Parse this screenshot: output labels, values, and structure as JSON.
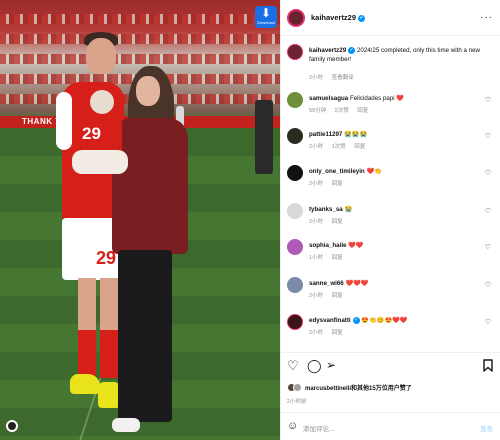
{
  "photo": {
    "banner_text": "THANK YOU",
    "man_number": "29",
    "baby_number": "29",
    "download_label": "Download"
  },
  "post": {
    "author": "kaihavertz29",
    "caption": "2024/25 completed, only this time with a new family member!",
    "caption_time": "2小时",
    "translate_label": "查看翻译",
    "more_label": "···"
  },
  "comments": [
    {
      "user": "samuelsagua",
      "text": "Felicidades papi ❤️",
      "time": "59分钟",
      "likes": "2次赞",
      "reply": "回复",
      "avatar_color": "#6b8f3b"
    },
    {
      "user": "pattie11297",
      "text": "😭😭😭",
      "time": "2小时",
      "likes": "1次赞",
      "reply": "回复",
      "avatar_color": "#2b2b1e"
    },
    {
      "user": "only_one_timileyin",
      "text": "❤️👏",
      "time": "2小时",
      "likes": "",
      "reply": "回复",
      "avatar_color": "#111111"
    },
    {
      "user": "tybanks_sa",
      "text": "😭",
      "time": "2小时",
      "likes": "",
      "reply": "回复",
      "avatar_color": "#d8d8d8"
    },
    {
      "user": "sophia_haile",
      "text": "❤️❤️",
      "time": "1小时",
      "likes": "",
      "reply": "回复",
      "avatar_color": "#b05ab8"
    },
    {
      "user": "sanne_wi66",
      "text": "❤️❤️❤️",
      "time": "2小时",
      "likes": "",
      "reply": "回复",
      "avatar_color": "#7a8aa8"
    },
    {
      "user": "edysvanfinatti",
      "text": "😍👏😊😍❤️❤️",
      "time": "2小时",
      "likes": "",
      "reply": "回复",
      "avatar_color": "#3a1616"
    }
  ],
  "liked_by": {
    "text": "marcusbettinelli和其他15万位用户赞了",
    "mini_colors": [
      "#5a4634",
      "#a0a0a0"
    ]
  },
  "post_time": "2小时前",
  "comment_input": {
    "placeholder": "添加评论...",
    "post_label": "发布"
  },
  "colors": {
    "verified": "#0095f6",
    "heart": "#e0245e",
    "story_ring": "#e1306c"
  }
}
